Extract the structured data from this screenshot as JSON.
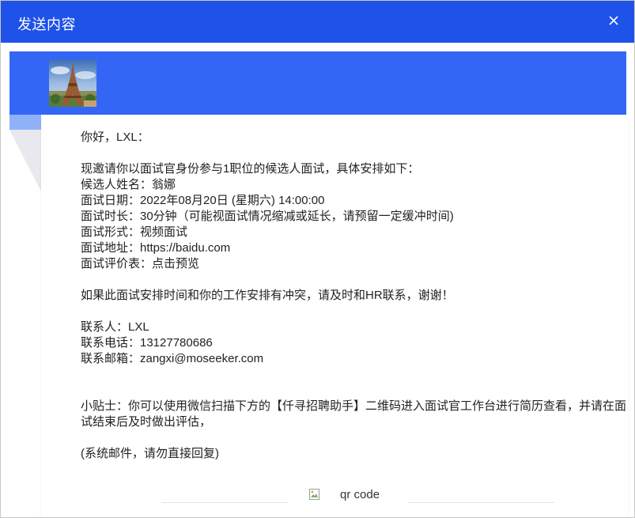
{
  "dialog": {
    "title": "发送内容",
    "close_icon": "close-icon"
  },
  "colors": {
    "header": "#1e52e8",
    "banner": "#3466f6",
    "fold": "#8fb1f7"
  },
  "email": {
    "logo_icon": "eiffel-tower-photo",
    "greeting": "你好，LXL：",
    "intro": "现邀请你以面试官身份参与1职位的候选人面试，具体安排如下：",
    "candidate": "候选人姓名：翁娜",
    "date": "面试日期：2022年08月20日 (星期六) 14:00:00",
    "duration": "面试时长：30分钟（可能视面试情况缩减或延长，请预留一定缓冲时间)",
    "format": "面试形式：视频面试",
    "address": "面试地址：https://baidu.com",
    "eval_form": "面试评价表：点击预览",
    "conflict": "如果此面试安排时间和你的工作安排有冲突，请及时和HR联系，谢谢！",
    "contact_person": "联系人：LXL",
    "contact_phone": "联系电话：13127780686",
    "contact_email": "联系邮箱：zangxi@moseeker.com",
    "tip": "小贴士：你可以使用微信扫描下方的【仟寻招聘助手】二维码进入面试官工作台进行简历查看，并请在面试结束后及时做出评估，",
    "system_note": "(系统邮件，请勿直接回复)",
    "qr_alt": "qr code"
  }
}
